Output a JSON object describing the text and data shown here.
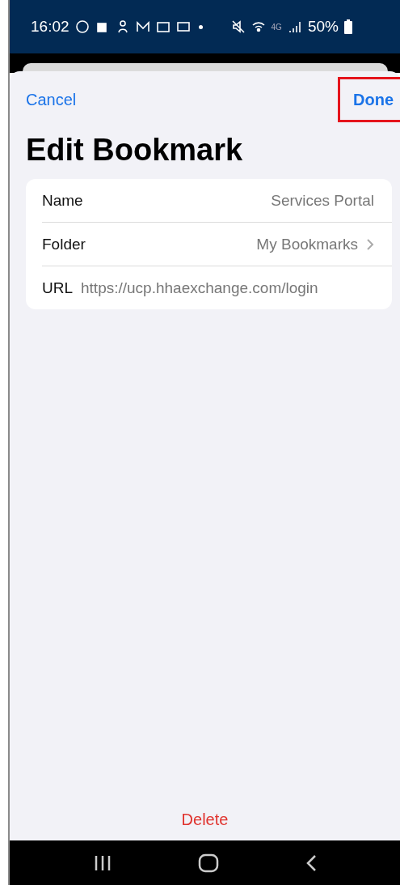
{
  "status_bar": {
    "time": "16:02",
    "network": "4G",
    "battery": "50%"
  },
  "sheet": {
    "cancel": "Cancel",
    "done": {
      "label": "Done",
      "highlighted": true
    },
    "title": "Edit Bookmark",
    "fields": [
      {
        "kind": "text",
        "label": "Name",
        "value": "Services Portal"
      },
      {
        "kind": "link",
        "label": "Folder",
        "value": "My Bookmarks"
      },
      {
        "kind": "url",
        "label": "URL",
        "value": "https://ucp.hhaexchange.com/login"
      }
    ],
    "delete": "Delete"
  }
}
